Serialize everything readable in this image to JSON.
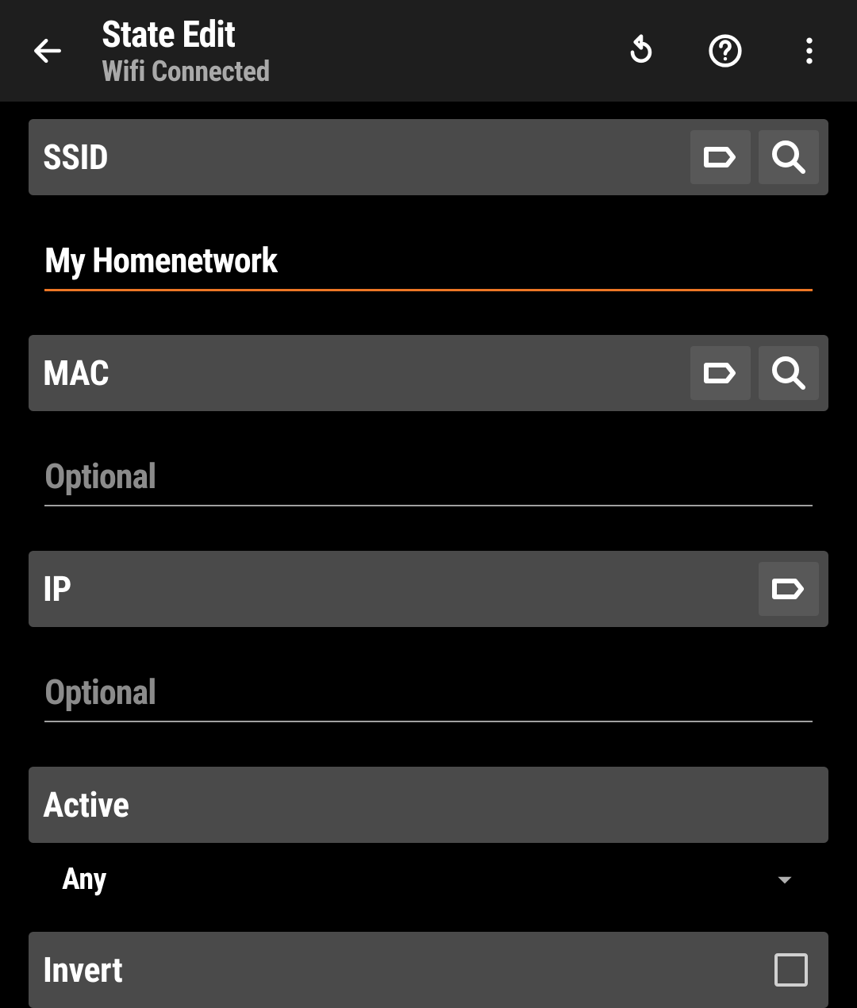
{
  "appbar": {
    "title": "State Edit",
    "subtitle": "Wifi Connected"
  },
  "ssid": {
    "label": "SSID",
    "value": "My Homenetwork"
  },
  "mac": {
    "label": "MAC",
    "placeholder": "Optional",
    "value": ""
  },
  "ip": {
    "label": "IP",
    "placeholder": "Optional",
    "value": ""
  },
  "active": {
    "label": "Active",
    "value": "Any"
  },
  "invert": {
    "label": "Invert",
    "checked": false
  },
  "accent_color": "#ed7625"
}
